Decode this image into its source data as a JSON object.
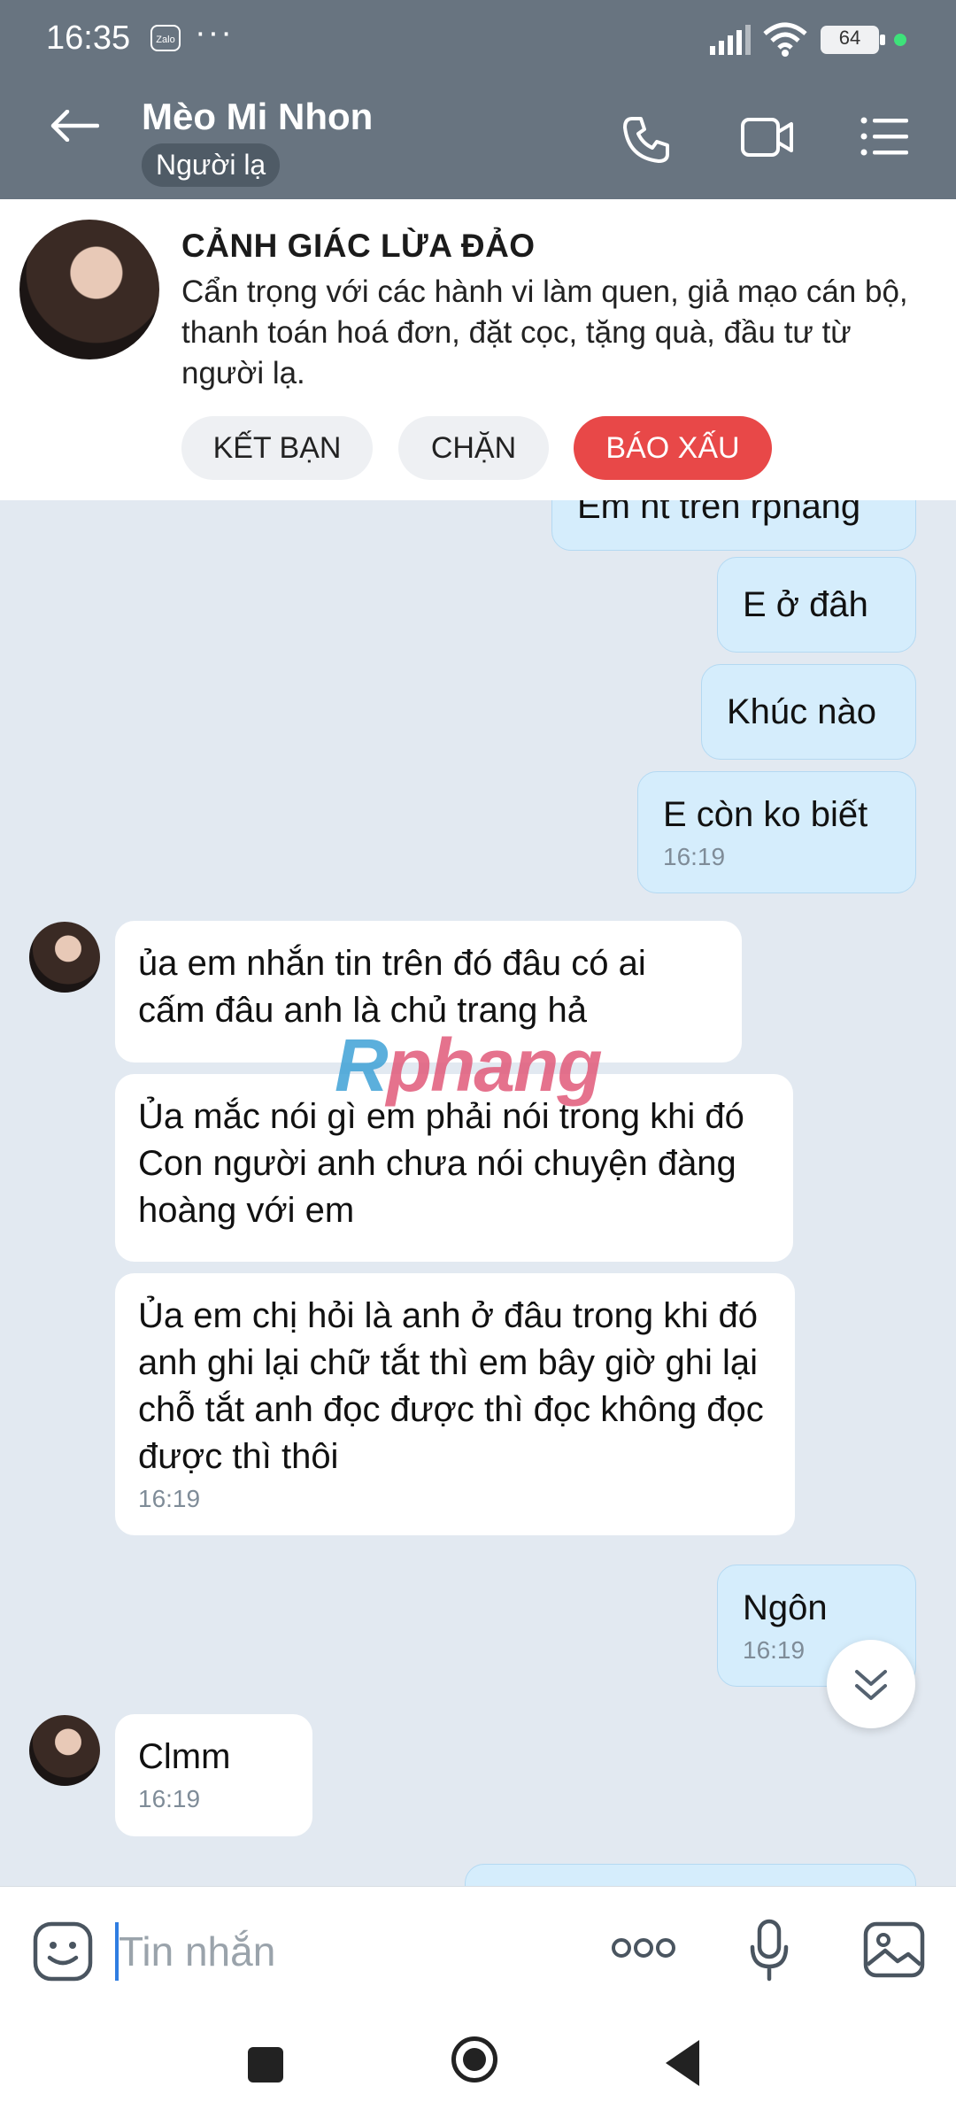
{
  "status_bar": {
    "time": "16:35",
    "app_badge": "Zalo",
    "more": "···",
    "battery": "64"
  },
  "header": {
    "contact_name": "Mèo Mi Nhon",
    "badge": "Người lạ"
  },
  "warning": {
    "title": "CẢNH GIÁC LỪA ĐẢO",
    "body": "Cẩn trọng với các hành vi làm quen, giả mạo cán bộ, thanh toán hoá đơn, đặt cọc, tặng quà, đầu tư từ người lạ.",
    "buttons": {
      "add_friend": "KẾT BẠN",
      "block": "CHẶN",
      "report": "BÁO XẤU"
    }
  },
  "messages": [
    {
      "side": "sent",
      "text": "Em nt trên rphang",
      "time": ""
    },
    {
      "side": "sent",
      "text": "E ở đâh",
      "time": ""
    },
    {
      "side": "sent",
      "text": "Khúc nào",
      "time": ""
    },
    {
      "side": "sent",
      "text": "E còn ko biết",
      "time": "16:19"
    },
    {
      "side": "recv",
      "text": "ủa em nhắn tin trên đó đâu có ai cấm đâu anh là chủ trang hả",
      "time": ""
    },
    {
      "side": "recv",
      "text": "Ủa mắc nói gì em phải nói trong khi đó Con người anh chưa nói chuyện đàng hoàng với em",
      "time": ""
    },
    {
      "side": "recv",
      "text": "Ủa em chị hỏi là anh ở đâu trong khi đó anh ghi lại chữ tắt thì em bây giờ ghi lại chỗ tắt anh đọc được thì đọc không đọc được thì thôi",
      "time": "16:19"
    },
    {
      "side": "sent",
      "text": "Ngôn",
      "time": "16:19"
    },
    {
      "side": "recv",
      "text": "Clmm",
      "time": "16:19"
    }
  ],
  "watermark": {
    "part1": "R",
    "part2": "phang"
  },
  "input": {
    "placeholder": "Tin nhắn"
  },
  "colors": {
    "header_bg": "#687480",
    "sent_bubble": "#d5edfc",
    "report_button": "#e84848",
    "chat_bg": "#e2e9f1"
  }
}
